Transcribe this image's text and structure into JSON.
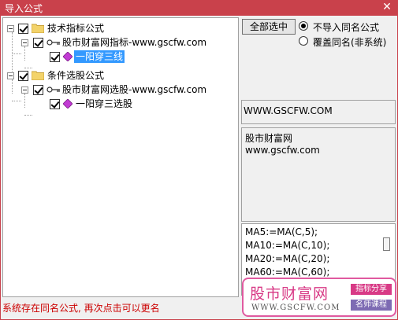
{
  "window": {
    "title": "导入公式",
    "close_symbol": "✕"
  },
  "tree": {
    "nodes": [
      {
        "label": "技术指标公式",
        "type": "folder",
        "checked": true,
        "expanded": true
      },
      {
        "label": "股市财富网指标-www.gscfw.com",
        "type": "key",
        "checked": true,
        "expanded": true
      },
      {
        "label": "一阳穿三线",
        "type": "gem",
        "checked": true,
        "selected": true
      },
      {
        "label": "条件选股公式",
        "type": "folder",
        "checked": true,
        "expanded": true
      },
      {
        "label": "股市财富网选股-www.gscfw.com",
        "type": "key",
        "checked": true,
        "expanded": true
      },
      {
        "label": "一阳穿三选股",
        "type": "gem",
        "checked": true
      }
    ]
  },
  "controls": {
    "select_all_label": "全部选中",
    "radio_options": [
      {
        "label": "不导入同名公式",
        "selected": true
      },
      {
        "label": "覆盖同名(非系统)",
        "selected": false
      }
    ]
  },
  "info": {
    "url_text": "WWW.GSCFW.COM",
    "desc_lines": [
      "股市财富网",
      "www.gscfw.com"
    ],
    "code_lines": [
      "MA5:=MA(C,5);",
      "MA10:=MA(C,10);",
      "MA20:=MA(C,20);",
      "MA60:=MA(C,60);"
    ]
  },
  "status": {
    "message": "系统存在同名公式, 再次点击可以更名"
  },
  "watermark": {
    "brand": "股市财富网",
    "site": "WWW.GSCFW.COM",
    "tag1": "指标分享",
    "tag2": "名师课程",
    "colors": {
      "pink": "#d83a86",
      "purple": "#7d6bb3"
    }
  },
  "theme": {
    "titlebar": "#c9414b",
    "status_text": "#cc0000",
    "selection": "#3399ff"
  }
}
